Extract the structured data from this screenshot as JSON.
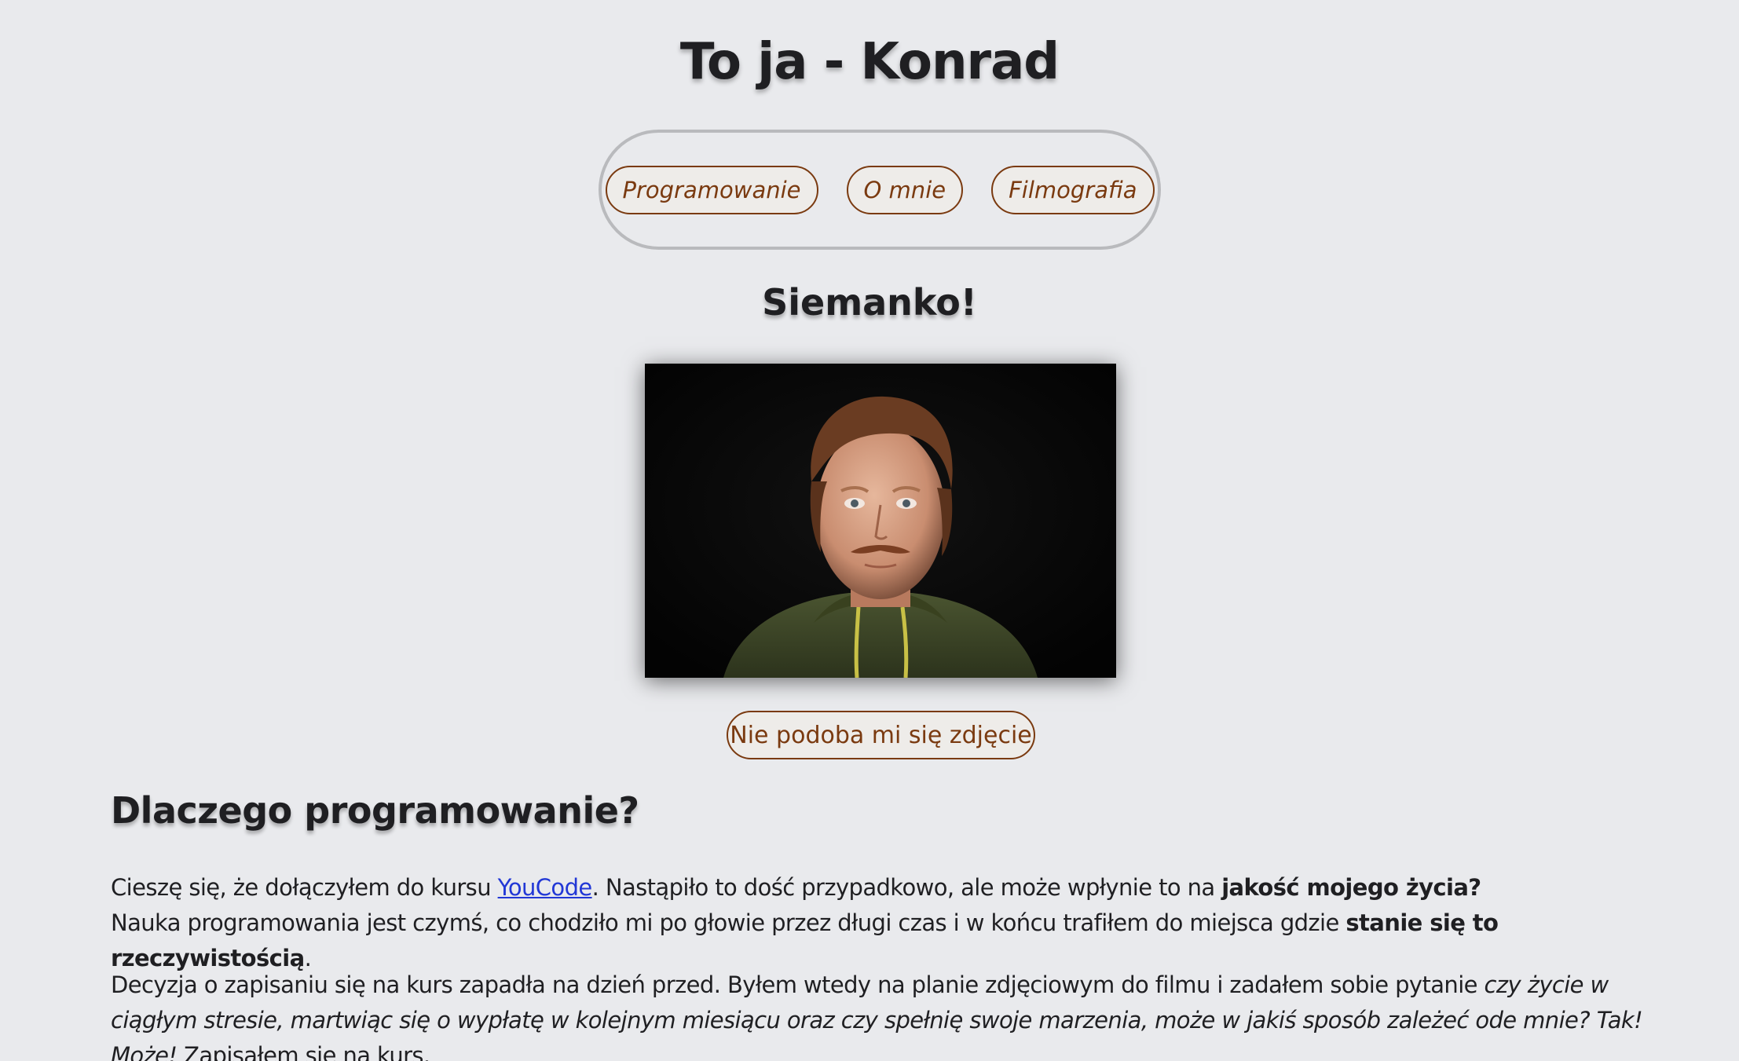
{
  "header": {
    "title": "To ja - Konrad"
  },
  "nav": {
    "items": [
      {
        "label": "Programowanie"
      },
      {
        "label": "O mnie"
      },
      {
        "label": "Filmografia"
      }
    ]
  },
  "greeting": {
    "title": "Siemanko!",
    "photo_button": "Nie podoba mi się zdjęcie"
  },
  "why": {
    "heading": "Dlaczego programowanie?",
    "p1": {
      "part1": "Cieszę się, że dołączyłem do kursu ",
      "link": "YouCode",
      "part2": ". Nastąpiło to dość przypadkowo, ale może wpłynie to na ",
      "bold1": "jakość mojego życia?",
      "part3": "Nauka programowania jest czymś, co chodziło mi po głowie przez długi czas i w końcu trafiłem do miejsca gdzie ",
      "bold2": "stanie się to rzeczywistością",
      "part4": "."
    },
    "p2": {
      "part1": "Decyzja o zapisaniu się na kurs zapadła na dzień przed. Byłem wtedy na planie zdjęciowym do filmu i zadałem sobie pytanie ",
      "italic1": "czy życie w ciągłym stresie, martwiąc się o wypłatę w kolejnym miesiącu oraz czy spełnię swoje marzenia, może w jakiś sposób zależeć ode mnie? Tak! Może!",
      "part2": " Zapisałem się na kurs."
    }
  },
  "colors": {
    "background": "#e9eaed",
    "accent": "#7a3a10",
    "link": "#2238d6",
    "text": "#1f1f22"
  }
}
